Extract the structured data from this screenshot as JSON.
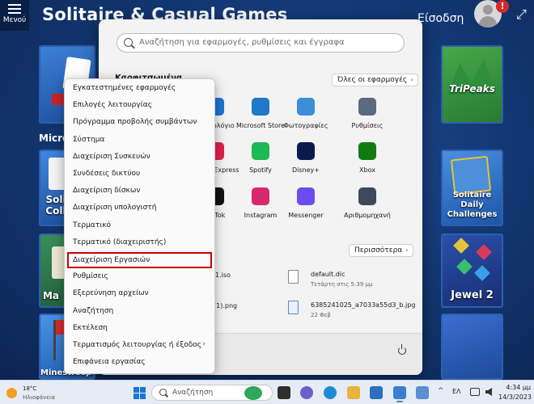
{
  "app": {
    "menu_label": "Μενού",
    "title": "Solitaire & Casual Games",
    "signin_label": "Είσοδση",
    "alert_badge": "!",
    "section_label": "Micro",
    "tiles": [
      {
        "label": "Soli Coll"
      },
      {
        "label": "Ma"
      },
      {
        "label": "Minesweeper"
      },
      {
        "label": "TriPeaks"
      },
      {
        "label": "Solitaire Daily Challenges"
      },
      {
        "label": "Jewel 2"
      }
    ]
  },
  "start_menu": {
    "search_placeholder": "Αναζήτηση για εφαρμογές, ρυθμίσεις και έγγραφα",
    "pinned_title": "Καρφιτσωμένα",
    "all_apps_label": "Όλες οι εφαρμογές",
    "apps": [
      {
        "name": "Ημερολόγιο",
        "icon": "calendar-icon",
        "color": "#1e73d2"
      },
      {
        "name": "Microsoft Store",
        "icon": "store-icon",
        "color": "#1f78c8"
      },
      {
        "name": "Φωτογραφίες",
        "icon": "photos-icon",
        "color": "#3a8fd8"
      },
      {
        "name": "Ρυθμίσεις",
        "icon": "settings-icon",
        "color": "#5a6b80"
      },
      {
        "name": "Adobe Express",
        "icon": "adobe-express-icon",
        "color": "#e0204a"
      },
      {
        "name": "Spotify",
        "icon": "spotify-icon",
        "color": "#1db954"
      },
      {
        "name": "Disney+",
        "icon": "disney-plus-icon",
        "color": "#0b1a4a"
      },
      {
        "name": "Xbox",
        "icon": "xbox-icon",
        "color": "#107c10"
      },
      {
        "name": "TikTok",
        "icon": "tiktok-icon",
        "color": "#111111"
      },
      {
        "name": "Instagram",
        "icon": "instagram-icon",
        "color": "#d6296e"
      },
      {
        "name": "Messenger",
        "icon": "messenger-icon",
        "color": "#6a4cf0"
      },
      {
        "name": "Αριθμομηχανή",
        "icon": "calculator-icon",
        "color": "#3c4a5a"
      }
    ],
    "more_label": "Περισσότερα",
    "recommended": [
      {
        "name": "default.dic",
        "date": "Τετάρτη στις 5:39 μμ"
      },
      {
        "name": "6385241025_a7033a55d3_b.jpg",
        "date": "22 Φεβ"
      }
    ],
    "partial_items": [
      "1.iso",
      "(1).png"
    ]
  },
  "context_menu": {
    "items": [
      {
        "label": "Εγκατεστημένες εφαρμογές"
      },
      {
        "label": "Επιλογές λειτουργίας"
      },
      {
        "label": "Πρόγραμμα προβολής συμβάντων"
      },
      {
        "label": "Σύστημα"
      },
      {
        "label": "Διαχείριση Συσκευών"
      },
      {
        "label": "Συνδέσεις δικτύου"
      },
      {
        "label": "Διαχείριση δίσκων"
      },
      {
        "label": "Διαχείριση υπολογιστή"
      },
      {
        "label": "Τερματικό"
      },
      {
        "label": "Τερματικό (διαχειριστής)"
      },
      {
        "label": "Διαχείριση Εργασιών",
        "highlighted": true
      },
      {
        "label": "Ρυθμίσεις"
      },
      {
        "label": "Εξερεύνηση αρχείων"
      },
      {
        "label": "Αναζήτηση"
      },
      {
        "label": "Εκτέλεση"
      },
      {
        "label": "Τερματισμός λειτουργίας ή έξοδος",
        "submenu": true
      },
      {
        "label": "Επιφάνεια εργασίας"
      }
    ]
  },
  "taskbar": {
    "weather_temp": "18°C",
    "weather_condition": "Ηλιοφάνεια",
    "search_label": "Αναζήτηση",
    "language": "ΕΛ",
    "time": "4:34 μμ",
    "date": "14/3/2023"
  }
}
